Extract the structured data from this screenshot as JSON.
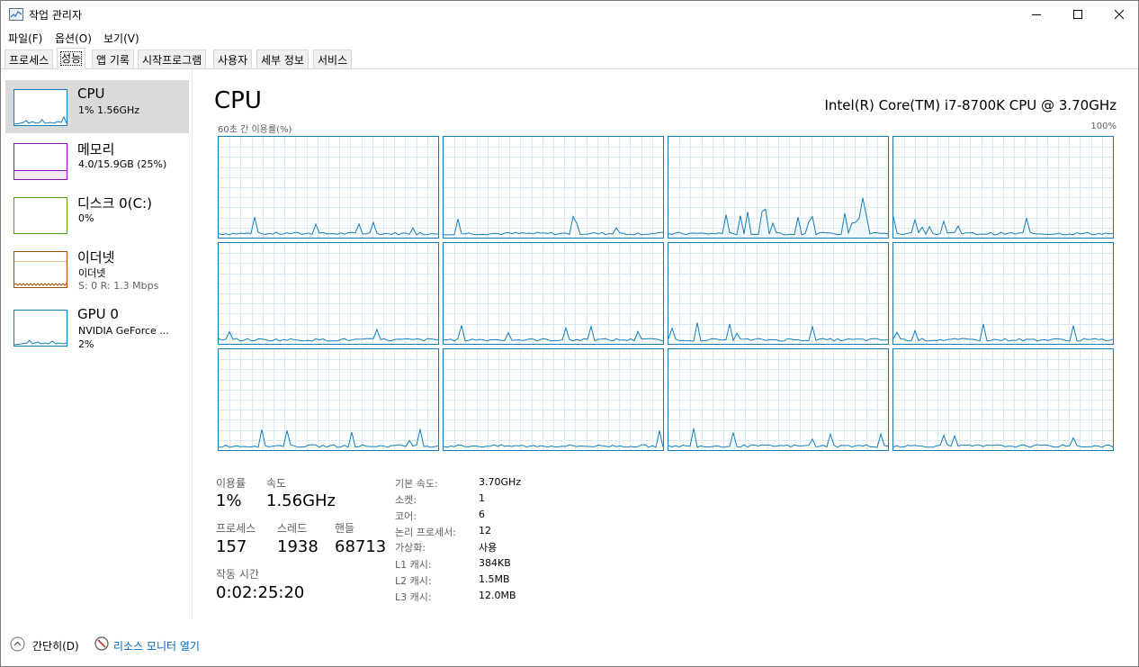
{
  "window": {
    "title": "작업 관리자"
  },
  "menu": [
    {
      "label": "파일(F)"
    },
    {
      "label": "옵션(O)"
    },
    {
      "label": "보기(V)"
    }
  ],
  "tabs": [
    {
      "label": "프로세스"
    },
    {
      "label": "성능"
    },
    {
      "label": "앱 기록"
    },
    {
      "label": "시작프로그램"
    },
    {
      "label": "사용자"
    },
    {
      "label": "세부 정보"
    },
    {
      "label": "서비스"
    }
  ],
  "active_tab": "성능",
  "sidebar": [
    {
      "title": "CPU",
      "line1": "1% 1.56GHz",
      "color": "#117dbb"
    },
    {
      "title": "메모리",
      "line1": "4.0/15.9GB (25%)",
      "color": "#8b12ae"
    },
    {
      "title": "디스크 0(C:)",
      "line1": "0%",
      "color": "#4da60c"
    },
    {
      "title": "이더넷",
      "line1": "이더넷",
      "line2": "S: 0 R: 1.3 Mbps",
      "color": "#a74f01"
    },
    {
      "title": "GPU 0",
      "line1": "NVIDIA GeForce ...",
      "line2": "2%",
      "color": "#117dbb"
    }
  ],
  "main": {
    "heading": "CPU",
    "model": "Intel(R) Core(TM) i7-8700K CPU @ 3.70GHz",
    "graph_label": "60초 간 이용률(%)",
    "graph_max": "100%",
    "core_count": 12
  },
  "stats": {
    "util_label": "이용률",
    "util_value": "1%",
    "speed_label": "속도",
    "speed_value": "1.56GHz",
    "proc_label": "프로세스",
    "proc_value": "157",
    "thread_label": "스레드",
    "thread_value": "1938",
    "handle_label": "핸들",
    "handle_value": "68713",
    "uptime_label": "작동 시간",
    "uptime_value": "0:02:25:20"
  },
  "specs": [
    {
      "label": "기본 속도:",
      "value": "3.70GHz"
    },
    {
      "label": "소켓:",
      "value": "1"
    },
    {
      "label": "코어:",
      "value": "6"
    },
    {
      "label": "논리 프로세서:",
      "value": "12"
    },
    {
      "label": "가상화:",
      "value": "사용"
    },
    {
      "label": "L1 캐시:",
      "value": "384KB"
    },
    {
      "label": "L2 캐시:",
      "value": "1.5MB"
    },
    {
      "label": "L3 캐시:",
      "value": "12.0MB"
    }
  ],
  "footer": {
    "less_details": "간단히(D)",
    "resource_monitor": "리소스 모니터 열기"
  },
  "colors": {
    "cpu": "#117dbb",
    "memory": "#8b12ae",
    "disk": "#4da60c",
    "ethernet": "#a74f01",
    "grid": "#d9eaf4",
    "link": "#0066cc"
  }
}
